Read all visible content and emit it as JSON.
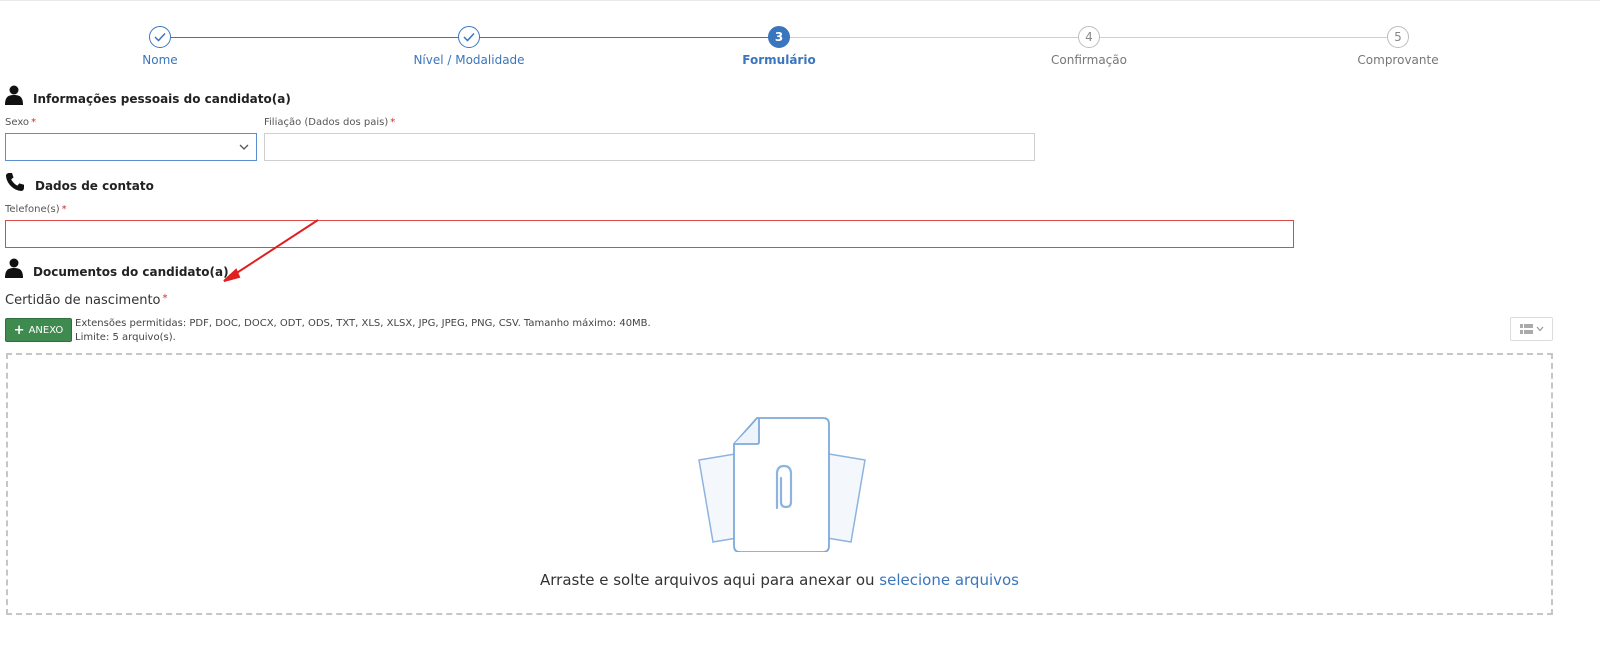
{
  "stepper": {
    "steps": [
      {
        "number": "1",
        "label": "Nome",
        "state": "done"
      },
      {
        "number": "2",
        "label": "Nível / Modalidade",
        "state": "done"
      },
      {
        "number": "3",
        "label": "Formulário",
        "state": "active"
      },
      {
        "number": "4",
        "label": "Confirmação",
        "state": "todo"
      },
      {
        "number": "5",
        "label": "Comprovante",
        "state": "todo"
      }
    ]
  },
  "personal": {
    "title": "Informações pessoais do candidato(a)",
    "icon": "user-icon",
    "sexo_label": "Sexo",
    "sexo_value": "",
    "filiacao_label": "Filiação (Dados dos pais)",
    "filiacao_value": ""
  },
  "contact": {
    "title": "Dados de contato",
    "icon": "phone-icon",
    "telefone_label": "Telefone(s)",
    "telefone_value": ""
  },
  "documents": {
    "title": "Documentos do candidato(a)",
    "icon": "user-icon",
    "certidao_label": "Certidão de nascimento",
    "anexo_label": "ANEXO",
    "extensions_text": "Extensões permitidas: PDF, DOC, DOCX, ODT, ODS, TXT, XLS, XLSX, JPG, JPEG, PNG, CSV. Tamanho máximo: 40MB.",
    "limit_text": "Limite: 5 arquivo(s).",
    "drop_text": "Arraste e solte arquivos aqui para anexar ou",
    "drop_link": "selecione arquivos"
  },
  "required_mark": "*",
  "colors": {
    "primary": "#3a76bd",
    "success": "#3f8a4f",
    "error": "#d94a4a",
    "annotation_arrow": "#e02020"
  }
}
